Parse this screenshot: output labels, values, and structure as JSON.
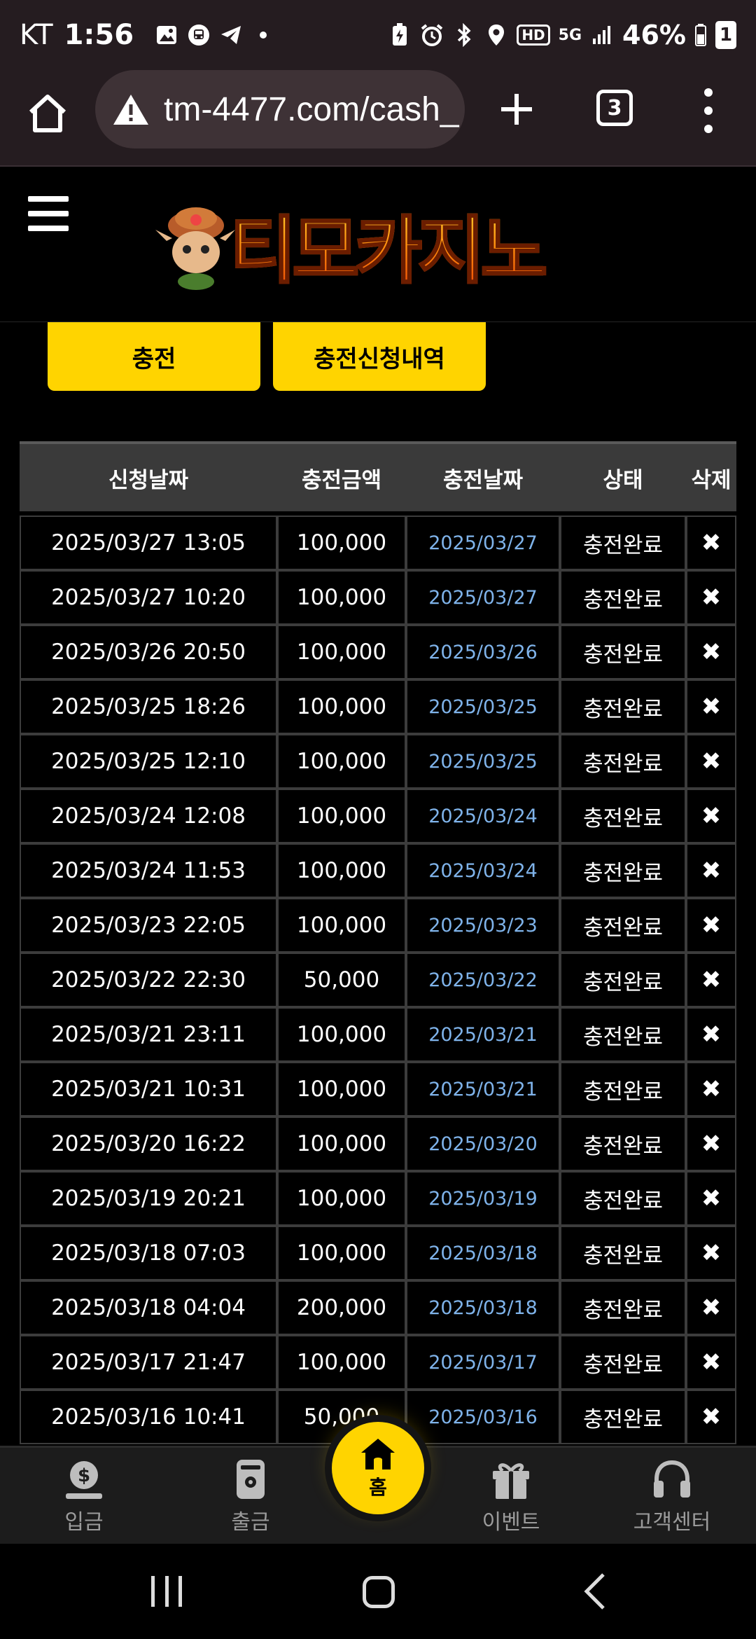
{
  "status_bar": {
    "carrier": "KT",
    "time": "1:56",
    "battery_percent": "46%",
    "battery_badge": "1",
    "network_hd": "HD",
    "network_5g": "5G"
  },
  "browser": {
    "url": "tm-4477.com/cash_",
    "tab_count": "3"
  },
  "site": {
    "logo_text": "티모카지노"
  },
  "actions": {
    "charge_label": "충전",
    "history_label": "충전신청내역"
  },
  "table": {
    "headers": [
      "신청날짜",
      "충전금액",
      "충전날짜",
      "상태",
      "삭제"
    ],
    "rows": [
      {
        "requested": "2025/03/27 13:05",
        "amount": "100,000",
        "charged": "2025/03/27",
        "status": "충전완료",
        "delete": "✖"
      },
      {
        "requested": "2025/03/27 10:20",
        "amount": "100,000",
        "charged": "2025/03/27",
        "status": "충전완료",
        "delete": "✖"
      },
      {
        "requested": "2025/03/26 20:50",
        "amount": "100,000",
        "charged": "2025/03/26",
        "status": "충전완료",
        "delete": "✖"
      },
      {
        "requested": "2025/03/25 18:26",
        "amount": "100,000",
        "charged": "2025/03/25",
        "status": "충전완료",
        "delete": "✖"
      },
      {
        "requested": "2025/03/25 12:10",
        "amount": "100,000",
        "charged": "2025/03/25",
        "status": "충전완료",
        "delete": "✖"
      },
      {
        "requested": "2025/03/24 12:08",
        "amount": "100,000",
        "charged": "2025/03/24",
        "status": "충전완료",
        "delete": "✖"
      },
      {
        "requested": "2025/03/24 11:53",
        "amount": "100,000",
        "charged": "2025/03/24",
        "status": "충전완료",
        "delete": "✖"
      },
      {
        "requested": "2025/03/23 22:05",
        "amount": "100,000",
        "charged": "2025/03/23",
        "status": "충전완료",
        "delete": "✖"
      },
      {
        "requested": "2025/03/22 22:30",
        "amount": "50,000",
        "charged": "2025/03/22",
        "status": "충전완료",
        "delete": "✖"
      },
      {
        "requested": "2025/03/21 23:11",
        "amount": "100,000",
        "charged": "2025/03/21",
        "status": "충전완료",
        "delete": "✖"
      },
      {
        "requested": "2025/03/21 10:31",
        "amount": "100,000",
        "charged": "2025/03/21",
        "status": "충전완료",
        "delete": "✖"
      },
      {
        "requested": "2025/03/20 16:22",
        "amount": "100,000",
        "charged": "2025/03/20",
        "status": "충전완료",
        "delete": "✖"
      },
      {
        "requested": "2025/03/19 20:21",
        "amount": "100,000",
        "charged": "2025/03/19",
        "status": "충전완료",
        "delete": "✖"
      },
      {
        "requested": "2025/03/18 07:03",
        "amount": "100,000",
        "charged": "2025/03/18",
        "status": "충전완료",
        "delete": "✖"
      },
      {
        "requested": "2025/03/18 04:04",
        "amount": "200,000",
        "charged": "2025/03/18",
        "status": "충전완료",
        "delete": "✖"
      },
      {
        "requested": "2025/03/17 21:47",
        "amount": "100,000",
        "charged": "2025/03/17",
        "status": "충전완료",
        "delete": "✖"
      },
      {
        "requested": "2025/03/16 10:41",
        "amount": "50,000",
        "charged": "2025/03/16",
        "status": "충전완료",
        "delete": "✖"
      }
    ]
  },
  "bottom_nav": {
    "deposit": "입금",
    "withdraw": "출금",
    "home": "홈",
    "event": "이벤트",
    "support": "고객센터"
  },
  "colors": {
    "accent_yellow": "#ffd400",
    "link_blue": "#7fb3ea",
    "browser_bg": "#251c20"
  },
  "icons": {
    "status": [
      "gallery-icon",
      "bus-icon",
      "telegram-icon",
      "dot-icon",
      "battery-saver-icon",
      "alarm-icon",
      "bluetooth-icon",
      "location-icon",
      "hd-icon",
      "5g-icon",
      "signal-icon",
      "battery-icon"
    ],
    "browser": [
      "home-icon",
      "warning-icon",
      "plus-icon",
      "tabs-icon",
      "kebab-menu-icon"
    ],
    "nav": [
      "dollar-coin-icon",
      "wallet-icon",
      "home-icon",
      "gift-icon",
      "headset-icon"
    ]
  }
}
